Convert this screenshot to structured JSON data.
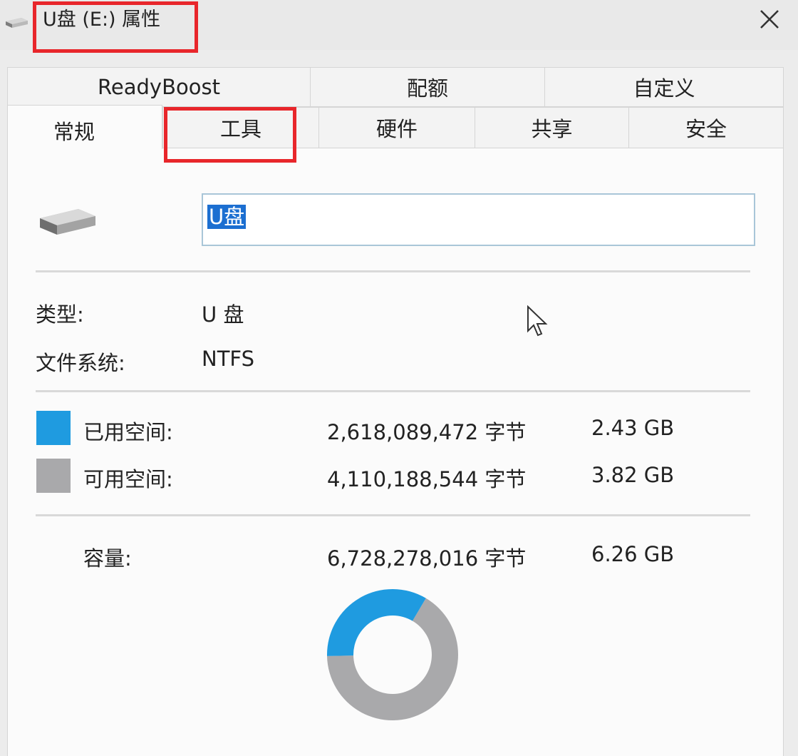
{
  "window": {
    "title": "U盘 (E:) 属性",
    "close_symbol": "✕"
  },
  "tabs_row1": [
    "ReadyBoost",
    "配额",
    "自定义"
  ],
  "tabs_row2": [
    "常规",
    "工具",
    "硬件",
    "共享",
    "安全"
  ],
  "active_tab": "常规",
  "general": {
    "name_value": "U盘",
    "type_label": "类型:",
    "type_value": "U 盘",
    "fs_label": "文件系统:",
    "fs_value": "NTFS",
    "used_label": "已用空间:",
    "used_bytes": "2,618,089,472 字节",
    "used_size": "2.43 GB",
    "free_label": "可用空间:",
    "free_bytes": "4,110,188,544 字节",
    "free_size": "3.82 GB",
    "capacity_label": "容量:",
    "capacity_bytes": "6,728,278,016 字节",
    "capacity_size": "6.26 GB",
    "used_fraction": 0.389
  },
  "colors": {
    "used": "#1f9be0",
    "free": "#a9a9ab",
    "highlight": "#e8262b"
  },
  "icons": [
    "usb-drive-icon",
    "close-icon",
    "mouse-cursor-icon"
  ]
}
